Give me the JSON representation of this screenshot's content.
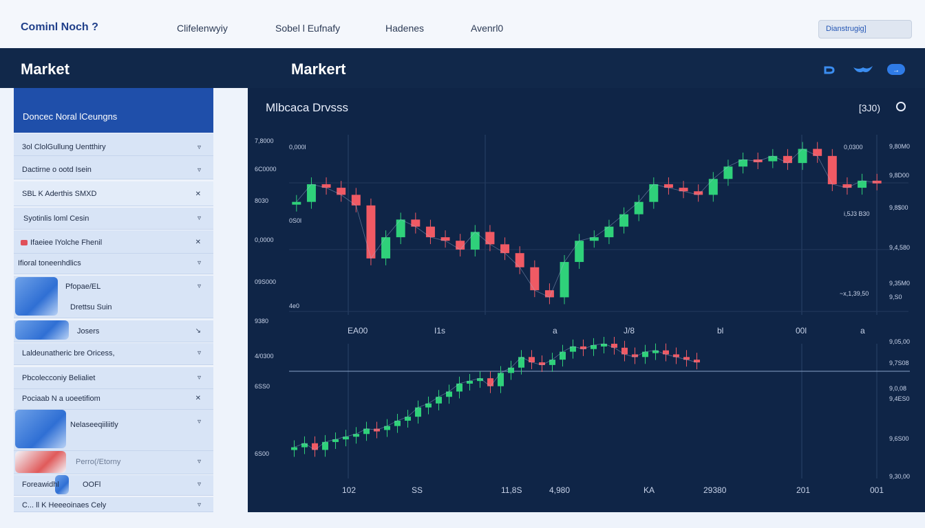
{
  "nav": {
    "brand": "Cominl Noch ?",
    "links": [
      "Clifelenwyiy",
      "Sobel l Eufnafy",
      "Hadenes",
      "Avenrl0"
    ],
    "search_placeholder": "Dianstrugig]"
  },
  "header": {
    "left_title": "Market",
    "main_title": "Markert"
  },
  "sidebar": {
    "heading": "Doncec  Noral lCeungns",
    "items": [
      {
        "label": "3ol ClolGullung Uentthiry"
      },
      {
        "label": "Dactirne  o ootd Isein"
      },
      {
        "label": "SBL K Aderthis SMXD"
      },
      {
        "label": "Syotinlis loml Cesin"
      },
      {
        "label": "Ifaeiee lYolche Fhenil"
      },
      {
        "label": "Ifioral toneenhdlics"
      },
      {
        "label": "Pfopae/EL"
      },
      {
        "label": "Drettsu Suin"
      },
      {
        "label": "Josers"
      },
      {
        "label": "Laldeunatheric bre Oricess,"
      },
      {
        "label": "Pbcolecconiy Belialiet"
      },
      {
        "label": "Pociaab N a uoeetifiom"
      },
      {
        "label": "Nelaseeqiiliitly"
      },
      {
        "label": "Perro(/Etorny"
      },
      {
        "label": "Foreawidhl"
      },
      {
        "label": "OOFl"
      },
      {
        "label": "C... ll K Heeeoinaes Cely"
      }
    ]
  },
  "main": {
    "chart_title": "Mlbcaca Drvsss",
    "price": "[3J0)",
    "upper_left_ticks": [
      "7,8000",
      "6C0000",
      "8030",
      "0,0000",
      "09S000",
      "9380"
    ],
    "upper_right_ticks": [
      "9,80M0",
      "9,8D00",
      "9,8$00",
      "9,4,580",
      "9,35M0",
      "9,S0"
    ],
    "upper_inline_labels": [
      "0,000l",
      "0,0300",
      "i,5J3 B30",
      "~x,1,39,50",
      "0S0l",
      "4e0"
    ],
    "mid_axis": [
      "EA00",
      "I1s",
      "a",
      "J/8",
      "bl",
      "00l",
      "a"
    ],
    "lower_left_ticks": [
      "4/0300",
      "6SS0",
      "6S00"
    ],
    "lower_right_ticks": [
      "9,05,00",
      "9,4ES0",
      "9,6S00",
      "9,7S08",
      "9,0,08",
      "9,30,00"
    ],
    "bottom_axis": [
      "102",
      "SS",
      "11,8S",
      "4,980",
      "KA",
      "29380",
      "201",
      "001"
    ]
  },
  "chart_data": [
    {
      "type": "line",
      "title": "Mlbcaca Drvsss",
      "x": [
        0,
        1,
        2,
        3,
        4,
        5,
        6,
        7,
        8,
        9,
        10,
        11,
        12,
        13,
        14,
        15,
        16,
        17,
        18,
        19,
        20,
        21,
        22,
        23,
        24,
        25,
        26,
        27,
        28,
        29,
        30,
        31,
        32,
        33,
        34,
        35,
        36,
        37,
        38,
        39
      ],
      "series": [
        {
          "values": [
            0.62,
            0.72,
            0.7,
            0.66,
            0.6,
            0.3,
            0.42,
            0.52,
            0.48,
            0.42,
            0.4,
            0.35,
            0.45,
            0.38,
            0.33,
            0.25,
            0.12,
            0.08,
            0.28,
            0.4,
            0.42,
            0.48,
            0.55,
            0.62,
            0.72,
            0.7,
            0.68,
            0.66,
            0.75,
            0.82,
            0.86,
            0.85,
            0.88,
            0.84,
            0.92,
            0.88,
            0.72,
            0.7,
            0.74,
            0.73
          ]
        }
      ],
      "grid": true
    },
    {
      "type": "line",
      "x": [
        0,
        1,
        2,
        3,
        4,
        5,
        6,
        7,
        8,
        9,
        10,
        11,
        12,
        13,
        14,
        15,
        16,
        17,
        18,
        19,
        20,
        21,
        22,
        23,
        24,
        25,
        26,
        27,
        28,
        29,
        30,
        31,
        32,
        33,
        34,
        35,
        36,
        37,
        38,
        39
      ],
      "series": [
        {
          "values": [
            0.22,
            0.25,
            0.2,
            0.26,
            0.28,
            0.3,
            0.32,
            0.36,
            0.35,
            0.38,
            0.42,
            0.45,
            0.52,
            0.55,
            0.6,
            0.64,
            0.7,
            0.72,
            0.74,
            0.68,
            0.78,
            0.82,
            0.9,
            0.86,
            0.84,
            0.88,
            0.94,
            0.98,
            0.96,
            0.99,
            1.0,
            0.97,
            0.92,
            0.9,
            0.94,
            0.95,
            0.92,
            0.9,
            0.88,
            0.86
          ]
        }
      ],
      "grid": true
    }
  ],
  "colors": {
    "up": "#2fd17a",
    "down": "#f05a64",
    "panel": "#0f2547",
    "header": "#11284a",
    "accent": "#1f4faa"
  }
}
